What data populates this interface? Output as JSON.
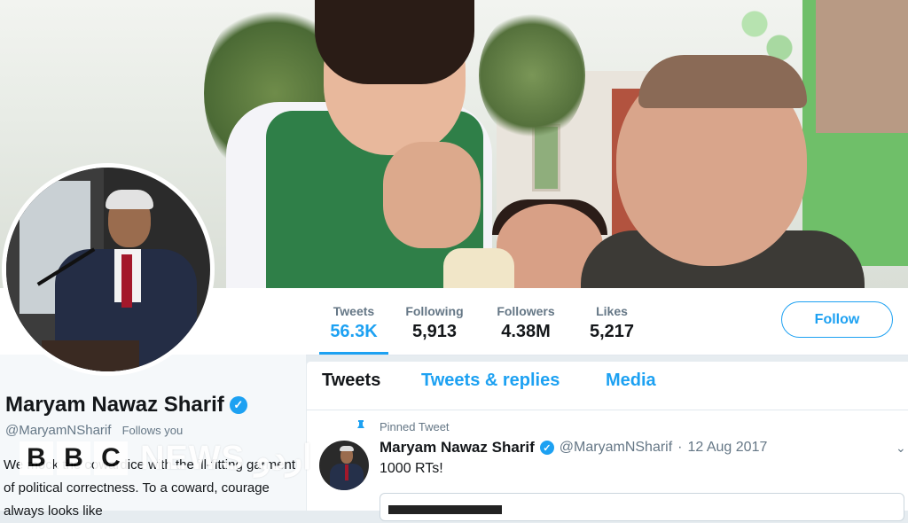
{
  "profile": {
    "name": "Maryam Nawaz Sharif",
    "handle": "@MaryamNSharif",
    "follows_you": "Follows you",
    "bio": "We mock the cowardice with the ill-fitting garment of political correctness. To a coward, courage always looks like"
  },
  "stats": [
    {
      "label": "Tweets",
      "value": "56.3K",
      "active": true
    },
    {
      "label": "Following",
      "value": "5,913",
      "active": false
    },
    {
      "label": "Followers",
      "value": "4.38M",
      "active": false
    },
    {
      "label": "Likes",
      "value": "5,217",
      "active": false
    }
  ],
  "follow_button": "Follow",
  "timeline": {
    "tabs": [
      "Tweets",
      "Tweets & replies",
      "Media"
    ],
    "pinned_label": "Pinned Tweet",
    "tweet": {
      "name": "Maryam Nawaz Sharif",
      "handle": "@MaryamNSharif",
      "separator": "·",
      "date": "12 Aug 2017",
      "text": "1000 RTs!"
    }
  },
  "watermark": {
    "letters": [
      "B",
      "B",
      "C"
    ],
    "service": "NEWS اردو"
  },
  "icons": {
    "verified": "verified-badge-icon",
    "pin": "pin-icon",
    "more": "chevron-down-icon"
  },
  "colors": {
    "accent": "#1da1f2",
    "secondary_text": "#657786",
    "primary_text": "#14171a"
  }
}
